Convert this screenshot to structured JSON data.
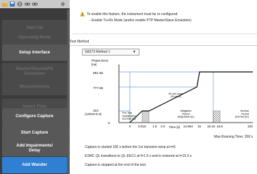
{
  "toolbar": {
    "icons": [
      "open-icon",
      "save-icon",
      "network-icon",
      "link-icon",
      "link-icon",
      "settings-icon"
    ]
  },
  "sidebar": {
    "items": [
      {
        "label": "Start Up",
        "state": "disabled"
      },
      {
        "label": "Operating Mode",
        "state": "disabled"
      },
      {
        "label": "Setup Interface",
        "state": "enabled"
      },
      {
        "label": "Master/Slave/GPS\nEmulation",
        "state": "disabled"
      },
      {
        "label": "Measurements",
        "state": "disabled"
      },
      {
        "label": "Select Flow",
        "state": "disabled"
      },
      {
        "label": "Configure Capture",
        "state": "enabled"
      },
      {
        "label": "Start Capture",
        "state": "enabled"
      },
      {
        "label": "Add Impairments/\nDelay",
        "state": "enabled"
      },
      {
        "label": "Add Wander",
        "state": "selected"
      }
    ]
  },
  "warning": {
    "line1": "To enable this feature, the instrument must be re-configured:",
    "line2": "- Enable Tx+Rx Mode (and/or enable PTP Master/Slave Emulation)"
  },
  "test_method": {
    "label": "Test Method",
    "selected": "G8273 Method 1"
  },
  "chart_data": {
    "type": "line",
    "ylabel": "Phase Error\n[ns]",
    "xlabel": "Time [s]",
    "y_ticks": [
      "881.56",
      "777.56",
      "104\n(120x0.9-4)",
      "0"
    ],
    "x_ticks": [
      "0",
      "0.016",
      "1.8",
      "2.0",
      "14.984",
      "15",
      "15.18",
      "15.5",
      "100"
    ],
    "x": [
      0,
      0.016,
      1.8,
      2.0,
      14.984,
      15,
      15.18,
      15.5,
      100
    ],
    "y": [
      0,
      104,
      104,
      104,
      777.56,
      881.56,
      881.56,
      881.56,
      881.56
    ],
    "annotations": {
      "slope": "45 ns/s slope\n(30 pk-fs)",
      "pre_test": "Pre-Test\nStabilization\n(normal QL)",
      "mitigation": "Mitigation\nPeriod\n(degraded QL)",
      "normal": "Normal\nPeriod\n(normal QL)"
    }
  },
  "max_running_time": "Max Running Time:  200 s",
  "notes": [
    "Capture is started 100 s before the 1st transient ramp at t=0.",
    "ESMC QL transitions to  QL-EEC1  at t=1.9 s and is restored at t=15.3 s.",
    "Capture is stopped at the end of the test."
  ]
}
